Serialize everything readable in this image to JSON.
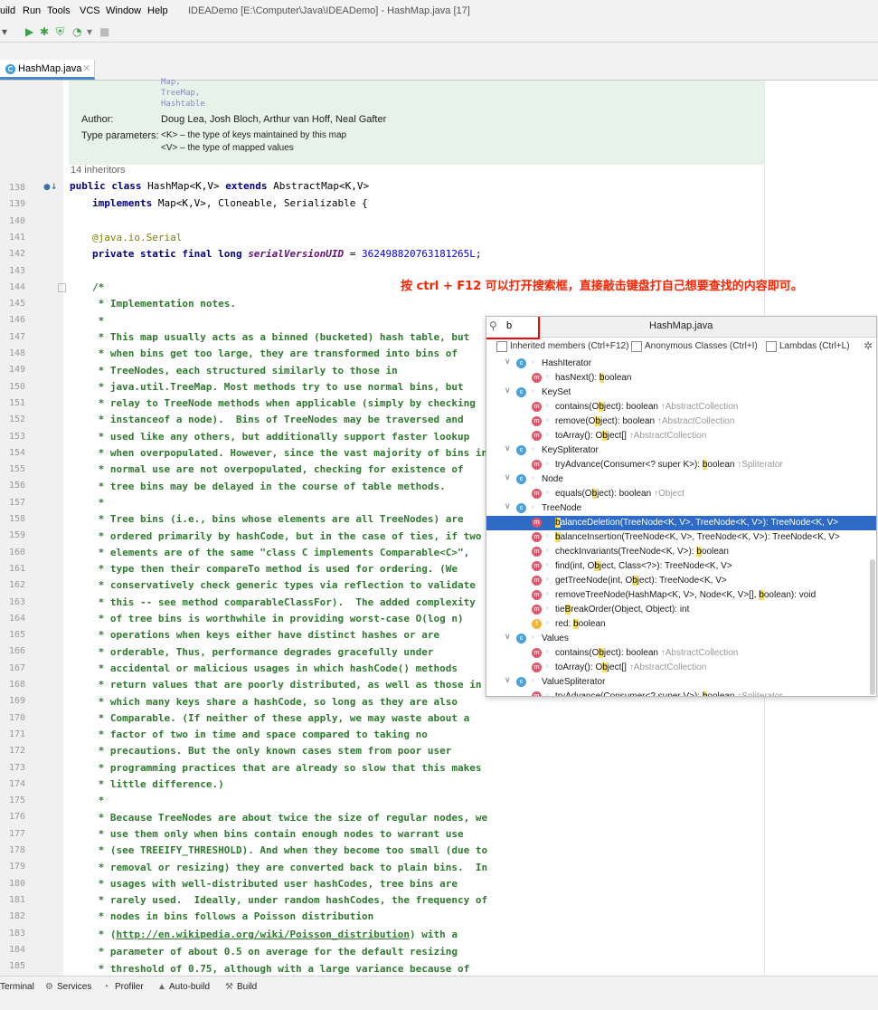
{
  "menubar": {
    "items": [
      "uild",
      "Run",
      "Tools",
      "VCS",
      "Window",
      "Help"
    ],
    "title": "IDEADemo [E:\\Computer\\Java\\IDEADemo] - HashMap.java [17]"
  },
  "tab": {
    "label": "HashMap.java",
    "icon": "C"
  },
  "doc": {
    "see_lines": [
      "Map,",
      "TreeMap,",
      "Hashtable"
    ],
    "author_label": "Author:",
    "author_value": "Doug Lea, Josh Bloch, Arthur van Hoff, Neal Gafter",
    "type_params_label": "Type parameters:",
    "type_param_k": "<K> – the type of keys maintained by this map",
    "type_param_v": "<V> – the type of mapped values",
    "inheritors": "14 inheritors"
  },
  "lines": [
    "138",
    "139",
    "140",
    "141",
    "142",
    "143",
    "144",
    "145",
    "146",
    "147",
    "148",
    "149",
    "150",
    "151",
    "152",
    "153",
    "154",
    "155",
    "156",
    "157",
    "158",
    "159",
    "160",
    "161",
    "162",
    "163",
    "164",
    "165",
    "166",
    "167",
    "168",
    "169",
    "170",
    "171",
    "172",
    "173",
    "174",
    "175",
    "176",
    "177",
    "178",
    "179",
    "180",
    "181",
    "182",
    "183",
    "184",
    "185"
  ],
  "code": {
    "l138": {
      "kw1": "public class ",
      "name": "HashMap<K,V> ",
      "kw2": "extends ",
      "rest": "AbstractMap<K,V>"
    },
    "l139": {
      "kw": "implements ",
      "rest": "Map<K,V>, Cloneable, Serializable {"
    },
    "l141": "@java.io.Serial",
    "l142": {
      "kw": "private static final long ",
      "name": "serialVersionUID",
      "eq": " = ",
      "num": "362498820763181265L",
      "end": ";"
    },
    "comments": [
      "/*",
      " * Implementation notes.",
      " *",
      " * This map usually acts as a binned (bucketed) hash table, but",
      " * when bins get too large, they are transformed into bins of",
      " * TreeNodes, each structured similarly to those in",
      " * java.util.TreeMap. Most methods try to use normal bins, but",
      " * relay to TreeNode methods when applicable (simply by checking",
      " * instanceof a node).  Bins of TreeNodes may be traversed and",
      " * used like any others, but additionally support faster lookup",
      " * when overpopulated. However, since the vast majority of bins in",
      " * normal use are not overpopulated, checking for existence of",
      " * tree bins may be delayed in the course of table methods.",
      " *",
      " * Tree bins (i.e., bins whose elements are all TreeNodes) are",
      " * ordered primarily by hashCode, but in the case of ties, if two",
      " * elements are of the same \"class C implements Comparable<C>\",",
      " * type then their compareTo method is used for ordering. (We",
      " * conservatively check generic types via reflection to validate",
      " * this -- see method comparableClassFor).  The added complexity",
      " * of tree bins is worthwhile in providing worst-case O(log n)",
      " * operations when keys either have distinct hashes or are",
      " * orderable, Thus, performance degrades gracefully under",
      " * accidental or malicious usages in which hashCode() methods",
      " * return values that are poorly distributed, as well as those in",
      " * which many keys share a hashCode, so long as they are also",
      " * Comparable. (If neither of these apply, we may waste about a",
      " * factor of two in time and space compared to taking no",
      " * precautions. But the only known cases stem from poor user",
      " * programming practices that are already so slow that this makes",
      " * little difference.)",
      " *",
      " * Because TreeNodes are about twice the size of regular nodes, we",
      " * use them only when bins contain enough nodes to warrant use",
      " * (see TREEIFY_THRESHOLD). And when they become too small (due to",
      " * removal or resizing) they are converted back to plain bins.  In",
      " * usages with well-distributed user hashCodes, tree bins are",
      " * rarely used.  Ideally, under random hashCodes, the frequency of",
      " * nodes in bins follows a Poisson distribution"
    ],
    "l183_pre": " * (",
    "l183_link": "http://en.wikipedia.org/wiki/Poisson_distribution",
    "l183_post": ") with a",
    "l184": " * parameter of about 0.5 on average for the default resizing",
    "l185": " * threshold of 0.75, although with a large variance because of"
  },
  "callout": "按 ctrl + F12 可以打开搜索框，直接敲击键盘打自己想要查找的内容即可。",
  "popup": {
    "query": "b",
    "title": "HashMap.java",
    "options": [
      "Inherited members (Ctrl+F12)",
      "Anonymous Classes (Ctrl+I)",
      "Lambdas (Ctrl+L)"
    ],
    "rows": [
      {
        "kind": "class",
        "pre": "",
        "hl": "",
        "post": "HashIterator",
        "sfx": ""
      },
      {
        "kind": "method",
        "pre": "hasNext(): ",
        "hl": "b",
        "post": "oolean",
        "sfx": ""
      },
      {
        "kind": "class",
        "pre": "",
        "hl": "",
        "post": "KeySet",
        "sfx": ""
      },
      {
        "kind": "method",
        "pre": "contains(O",
        "hl": "b",
        "post": "ject): boolean",
        "sfx": " ↑AbstractCollection"
      },
      {
        "kind": "method",
        "pre": "remove(O",
        "hl": "b",
        "post": "ject): boolean",
        "sfx": " ↑AbstractCollection"
      },
      {
        "kind": "method",
        "pre": "toArray(): O",
        "hl": "b",
        "post": "ject[]",
        "sfx": " ↑AbstractCollection"
      },
      {
        "kind": "class",
        "pre": "",
        "hl": "",
        "post": "KeySpliterator",
        "sfx": ""
      },
      {
        "kind": "method",
        "pre": "tryAdvance(Consumer<? super K>): ",
        "hl": "b",
        "post": "oolean",
        "sfx": " ↑Spliterator"
      },
      {
        "kind": "class",
        "pre": "",
        "hl": "",
        "post": "Node",
        "sfx": ""
      },
      {
        "kind": "method",
        "pre": "equals(O",
        "hl": "b",
        "post": "ject): boolean",
        "sfx": " ↑Object"
      },
      {
        "kind": "class",
        "pre": "",
        "hl": "",
        "post": "TreeNode",
        "sfx": ""
      },
      {
        "kind": "method",
        "pre": "",
        "hl": "b",
        "post": "alanceDeletion(TreeNode<K, V>, TreeNode<K, V>): TreeNode<K, V>",
        "sfx": ""
      },
      {
        "kind": "method",
        "pre": "",
        "hl": "b",
        "post": "alanceInsertion(TreeNode<K, V>, TreeNode<K, V>): TreeNode<K, V>",
        "sfx": ""
      },
      {
        "kind": "method",
        "pre": "checkInvariants(TreeNode<K, V>): ",
        "hl": "b",
        "post": "oolean",
        "sfx": ""
      },
      {
        "kind": "method",
        "pre": "find(int, O",
        "hl": "b",
        "post": "ject, Class<?>): TreeNode<K, V>",
        "sfx": ""
      },
      {
        "kind": "method",
        "pre": "getTreeNode(int, O",
        "hl": "b",
        "post": "ject): TreeNode<K, V>",
        "sfx": ""
      },
      {
        "kind": "method",
        "pre": "removeTreeNode(HashMap<K, V>, Node<K, V>[], ",
        "hl": "b",
        "post": "oolean): void",
        "sfx": ""
      },
      {
        "kind": "method",
        "pre": "tie",
        "hl": "B",
        "post": "reakOrder(Object, Object): int",
        "sfx": ""
      },
      {
        "kind": "field",
        "pre": "red: ",
        "hl": "b",
        "post": "oolean",
        "sfx": ""
      },
      {
        "kind": "class",
        "pre": "",
        "hl": "",
        "post": "Values",
        "sfx": ""
      },
      {
        "kind": "method",
        "pre": "contains(O",
        "hl": "b",
        "post": "ject): boolean",
        "sfx": " ↑AbstractCollection"
      },
      {
        "kind": "method",
        "pre": "toArray(): O",
        "hl": "b",
        "post": "ject[]",
        "sfx": " ↑AbstractCollection"
      },
      {
        "kind": "class",
        "pre": "",
        "hl": "",
        "post": "ValueSpliterator",
        "sfx": ""
      },
      {
        "kind": "method",
        "pre": "tryAdvance(Consumer<? super V>): ",
        "hl": "b",
        "post": "oolean",
        "sfx": " ↑Spliterator"
      }
    ]
  },
  "statusbar": [
    "Terminal",
    "Services",
    "Profiler",
    "Auto-build",
    "Build"
  ]
}
